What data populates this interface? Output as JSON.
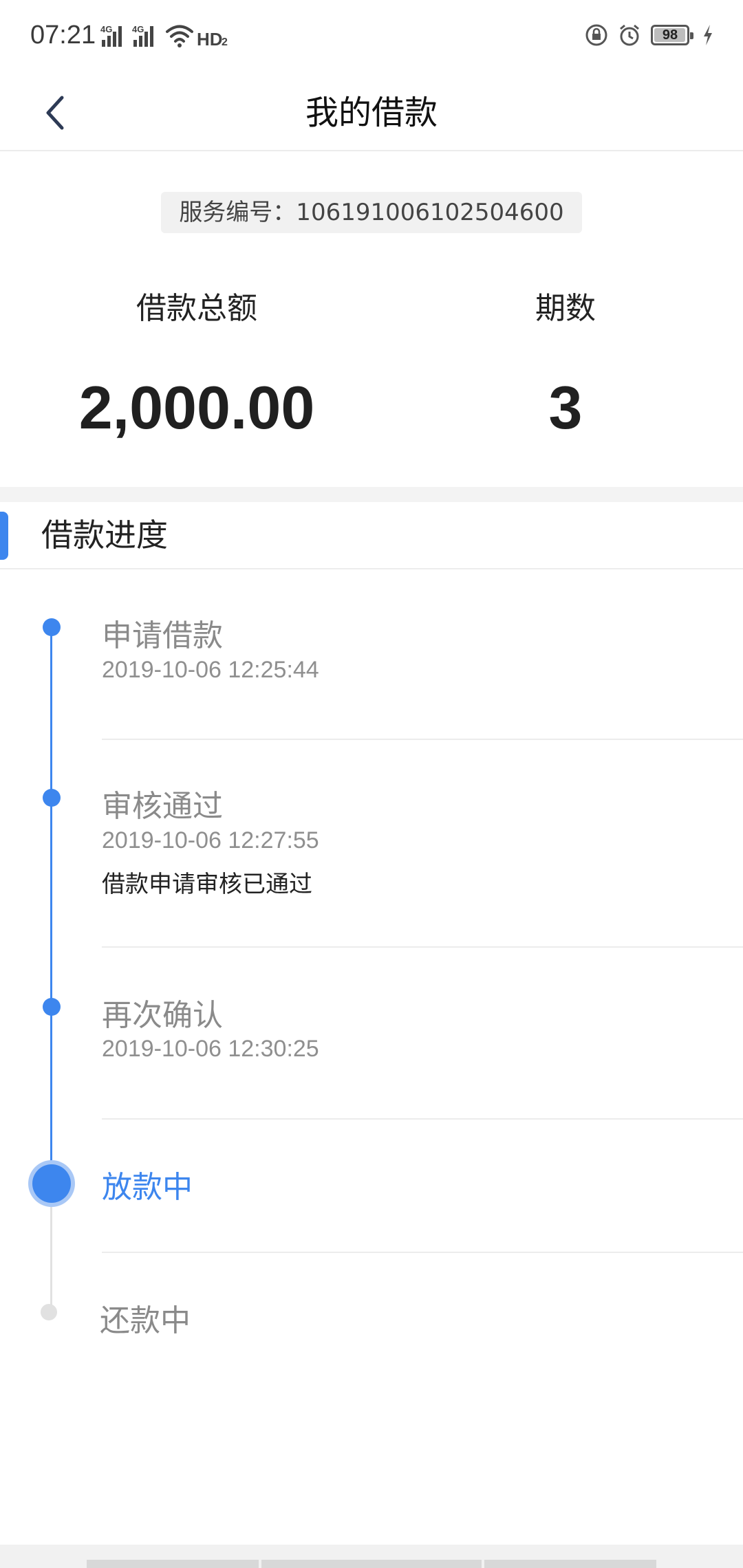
{
  "status_bar": {
    "time": "07:21",
    "net1": "4G",
    "net2": "4G",
    "hd": "HD",
    "hd_sub": "2",
    "battery": "98",
    "battery_level": 0.98,
    "icons": [
      "signal-icon",
      "signal-icon",
      "wifi-icon",
      "hd-icon",
      "lock-rotation-icon",
      "alarm-icon",
      "battery-icon",
      "charging-icon"
    ]
  },
  "nav": {
    "title": "我的借款",
    "back_icon": "chevron-left-icon"
  },
  "summary": {
    "service_no": "服务编号：106191006102504600",
    "total_label": "借款总额",
    "total_value": "2,000.00",
    "periods_label": "期数",
    "periods_value": "3"
  },
  "progress": {
    "title": "借款进度",
    "accent_color": "#3d86ee",
    "steps": [
      {
        "title": "申请借款",
        "time": "2019-10-06 12:25:44",
        "status": "done"
      },
      {
        "title": "审核通过",
        "time": "2019-10-06 12:27:55",
        "desc": "借款申请审核已通过",
        "status": "done"
      },
      {
        "title": "再次确认",
        "time": "2019-10-06 12:30:25",
        "status": "done"
      },
      {
        "title": "放款中",
        "status": "current"
      },
      {
        "title": "还款中",
        "status": "pending"
      }
    ]
  }
}
